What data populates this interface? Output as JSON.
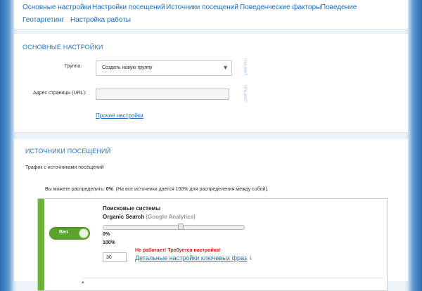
{
  "nav": {
    "row1": [
      "Основные настройки",
      "Настройки посещений",
      "Источники посещений",
      "Поведенческие факторы",
      "Поведение"
    ],
    "row2": [
      "Геотаргетинг",
      "Настройка работы"
    ]
  },
  "main_settings": {
    "title": "ОСНОВНЫЕ НАСТРОЙКИ",
    "group_label": "Группа:",
    "group_value": "Создать новую группу",
    "url_label": "Адрес страницы (URL):",
    "url_value": "",
    "other_settings_link": "Прочие настройки",
    "help_text": "Что это?"
  },
  "sources": {
    "title": "ИСТОЧНИКИ ПОСЕЩЕНИЙ",
    "subtitle": "Трафик с источниками посещений",
    "distribute_text_prefix": "Вы можете распределить: ",
    "distribute_value": "0%",
    "distribute_text_suffix": ". (На все источники дается 100% для распределения между собой).",
    "item": {
      "name": "Поисковые системы",
      "sub_name": "Organic Search",
      "sub_note": "(Google Analytics)",
      "toggle_label": "Вкл",
      "toggle_on": true,
      "slider_fraction": 0.55,
      "percent_a": "0%",
      "percent_b": "100%",
      "count_value": "30",
      "warning": "Не работает! Требуется настройка!",
      "keywords_link": "Детальные настройки ключевых фраз",
      "arrow_icon": "arrow-down-icon"
    }
  },
  "colors": {
    "accent": "#1b6fc2",
    "toggle_green": "#5aa42d",
    "warning_red": "#d8261b"
  }
}
